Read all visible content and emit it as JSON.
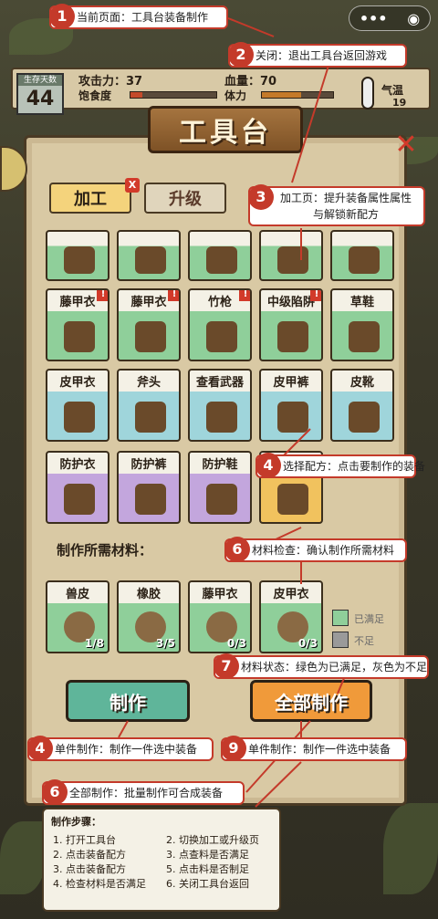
{
  "survive": {
    "label": "生存天数",
    "value": "44"
  },
  "stats": {
    "attack_label": "攻击力：37",
    "hunger_label": "饱食度",
    "hp_label": "血量：70",
    "stamina_label": "体力",
    "temp_label": "气温",
    "temp_value": "19",
    "hunger_value": "14",
    "stamina_value": "55"
  },
  "title": "工具台",
  "tabs": {
    "craft": "加工",
    "upgrade": "升级",
    "close_badge": "X"
  },
  "grid": [
    {
      "name": "",
      "bg": "green"
    },
    {
      "name": "",
      "bg": "green"
    },
    {
      "name": "",
      "bg": "green"
    },
    {
      "name": "",
      "bg": "green"
    },
    {
      "name": "",
      "bg": "green"
    },
    {
      "name": "藤甲衣",
      "bg": "green"
    },
    {
      "name": "藤甲衣",
      "bg": "green"
    },
    {
      "name": "竹枪",
      "bg": "green"
    },
    {
      "name": "中级陷阱",
      "bg": "green"
    },
    {
      "name": "草鞋",
      "bg": "green"
    },
    {
      "name": "皮甲衣",
      "bg": "blue"
    },
    {
      "name": "斧头",
      "bg": "blue"
    },
    {
      "name": "查看武器",
      "bg": "blue"
    },
    {
      "name": "皮甲裤",
      "bg": "blue"
    },
    {
      "name": "皮靴",
      "bg": "blue"
    },
    {
      "name": "防护衣",
      "bg": "purple"
    },
    {
      "name": "防护裤",
      "bg": "purple"
    },
    {
      "name": "防护鞋",
      "bg": "purple"
    },
    {
      "name": "",
      "bg": "gold"
    }
  ],
  "materials_label": "制作所需材料：",
  "materials": [
    {
      "name": "兽皮",
      "count": "1/8"
    },
    {
      "name": "橡胶",
      "count": "3/5"
    },
    {
      "name": "藤甲衣",
      "count": "0/3"
    },
    {
      "name": "皮甲衣",
      "count": "0/3"
    }
  ],
  "legend": {
    "ok": "已满足",
    "no": "不足"
  },
  "buttons": {
    "craft": "制作",
    "craft_all": "全部制作"
  },
  "callouts": [
    {
      "n": "1",
      "text": "当前页面：工具台装备制作"
    },
    {
      "n": "2",
      "text": "关闭：退出工具台返回游戏"
    },
    {
      "n": "3",
      "text": "加工页：提升装备属性属性与解锁新配方"
    },
    {
      "n": "4",
      "text": "选择配方：点击要制作的装备"
    },
    {
      "n": "6",
      "text": "材料检查：确认制作所需材料"
    },
    {
      "n": "7",
      "text": "材料状态：绿色为已满足，灰色为不足"
    },
    {
      "n": "4",
      "text": "单件制作：制作一件选中装备"
    },
    {
      "n": "9",
      "text": "单件制作：制作一件选中装备"
    },
    {
      "n": "6",
      "text": "全部制作：批量制作可合成装备"
    }
  ],
  "steps": {
    "title": "制作步骤：",
    "left": [
      "1. 打开工具台",
      "2. 点击装备配方",
      "3. 点击装备配方",
      "4. 检查材料是否满足"
    ],
    "right": [
      "2. 切换加工或升级页",
      "3. 点查料是否满足",
      "5. 点击料是否制足",
      "6. 关闭工具台返回"
    ]
  },
  "colors": {
    "accent": "#c43a2a",
    "green": "#8fcf9a",
    "blue": "#9fd5db",
    "purple": "#c3a6dd",
    "gold": "#f1c25e",
    "btn_green": "#5fb59a",
    "btn_orange": "#f09a3a"
  }
}
